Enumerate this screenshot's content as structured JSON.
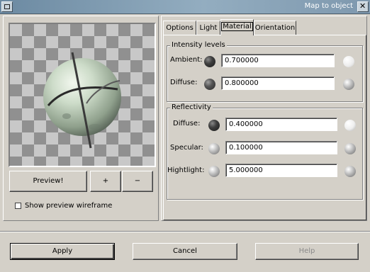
{
  "window": {
    "title": "Map to object"
  },
  "preview": {
    "preview_button": "Preview!",
    "zoom_in": "+",
    "zoom_out": "−",
    "wireframe_checkbox": {
      "label": "Show preview wireframe",
      "checked": false
    }
  },
  "tabs": [
    {
      "label": "Options",
      "active": false
    },
    {
      "label": "Light",
      "active": false
    },
    {
      "label": "Material",
      "active": true
    },
    {
      "label": "Orientation",
      "active": false
    }
  ],
  "intensity": {
    "title": "Intensity levels",
    "ambient": {
      "label": "Ambient:",
      "value": "0.700000"
    },
    "diffuse": {
      "label": "Diffuse:",
      "value": "0.800000"
    }
  },
  "reflectivity": {
    "title": "Reflectivity",
    "diffuse": {
      "label": "Diffuse:",
      "value": "0.400000"
    },
    "specular": {
      "label": "Specular:",
      "value": "0.100000"
    },
    "highlight": {
      "label": "Hightlight:",
      "value": "5.000000"
    }
  },
  "dialog_buttons": {
    "apply": "Apply",
    "cancel": "Cancel",
    "help": "Help"
  },
  "colors": {
    "titlebar": "#7e98ae",
    "background": "#d4d0c8",
    "sphere": "#b4c8b4"
  }
}
